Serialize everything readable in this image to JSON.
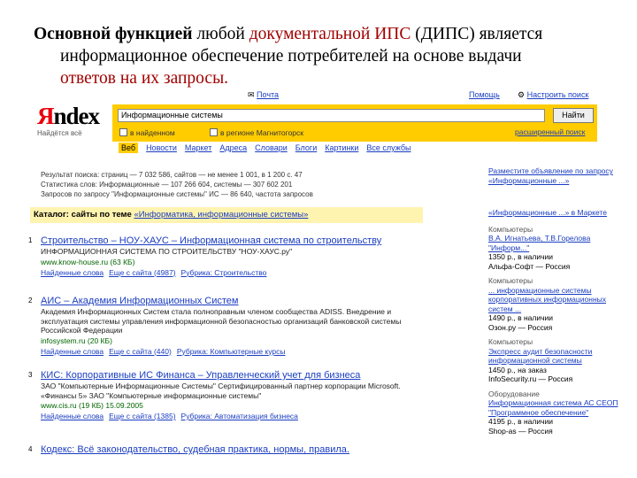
{
  "slide": {
    "title_bold": "Основной функцией",
    "title_1": " любой ",
    "title_red": "документальной ИПС",
    "title_2": " (ДИПС) является",
    "line2": "информационное обеспечение потребителей на основе выдачи",
    "line3": "ответов на их запросы."
  },
  "yandex": {
    "top_mail": "Почта",
    "top_help": "Помощь",
    "top_settings": "Настроить поиск",
    "logo_first": "Я",
    "logo_rest": "ndex",
    "logo_sub": "Найдётся всё",
    "query": "Информационные системы",
    "find_button": "Найти",
    "opt_found": "в найденном",
    "opt_region": "в регионе Магнитогорск",
    "advanced": "расширенный поиск",
    "tabs": [
      "Веб",
      "Новости",
      "Маркет",
      "Адреса",
      "Словари",
      "Блоги",
      "Картинки",
      "Все службы"
    ]
  },
  "stats": {
    "line1": "Результат поиска: страниц — 7 032 586, сайтов — не менее 1 001, в 1 200 с. 47",
    "line2": "Статистика слов: Информационные — 107 266 604, системы — 307 602 201",
    "line3": "Запросов по запросу \"Информационные системы\" ИС — 86 640, частота запросов"
  },
  "catalog": {
    "prefix": "Каталог: сайты по теме",
    "link": "«Информатика, информационные системы»"
  },
  "results": [
    {
      "num": "1",
      "title": "Строительство – НОУ-ХАУС – Информационная система по строительству",
      "snippet": "ИНФОРМАЦИОННАЯ СИСТЕМА ПО СТРОИТЕЛЬСТВУ \"НОУ-ХАУС.ру\"",
      "url": "www.know-house.ru (63 КБ)",
      "links": [
        "Найденные слова",
        "Еще с сайта (4987)",
        "Рубрика: Строительство"
      ]
    },
    {
      "num": "2",
      "title": "АИС – Академия Информационных Систем",
      "snippet": "Академия Информационных Систем стала полноправным членом сообщества ADISS. Внедрение и эксплуатация системы управления информационной безопасностью организаций банковской системы Российской Федерации",
      "url": "infosystem.ru (20 КБ)",
      "links": [
        "Найденные слова",
        "Еще с сайта (440)",
        "Рубрика: Компьютерные курсы"
      ]
    },
    {
      "num": "3",
      "title": "КИС: Корпоративные ИС Финанса – Управленческий учет для бизнеса",
      "snippet": "ЗАО \"Компьютерные Информационные Системы\" Сертифицированный партнер корпорации Microsoft. «Финансы 5» ЗАО \"Компьютерные информационные системы\"",
      "url": "www.cis.ru (19 КБ) 15.09.2005",
      "links": [
        "Найденные слова",
        "Еще с сайта (1385)",
        "Рубрика: Автоматизация бизнеса"
      ]
    },
    {
      "num": "4",
      "title": "Кодекс: Всё законодательство, судебная практика, нормы, правила.",
      "snippet": "",
      "url": "",
      "links": []
    }
  ],
  "right": {
    "head1": "Разместите объявление по запросу «Информационные ...»",
    "head2": "«Информационные ...» в Маркете",
    "ads": [
      {
        "cat": "Компьютеры",
        "title": "В.А. Игнатьева, Т.В.Горелова \"Информ...\"",
        "price": "1350 р., в наличии",
        "shop": "Альфа-Софт — Россия"
      },
      {
        "cat": "Компьютеры",
        "title": "... информационные системы корпоративных информационных систем ...",
        "price": "1490 р., в наличии",
        "shop": "Озон.ру — Россия"
      },
      {
        "cat": "Компьютеры",
        "title": "Экспресс аудит безопасности информационной системы",
        "price": "1450 р., на заказ",
        "shop": "InfoSecurity.ru — Россия"
      },
      {
        "cat": "Оборудование",
        "title": "Информационная система АС СЕОП \"Программное обеспечение\"",
        "price": "4195 р., в наличии",
        "shop": "Shop-as — Россия"
      }
    ]
  }
}
